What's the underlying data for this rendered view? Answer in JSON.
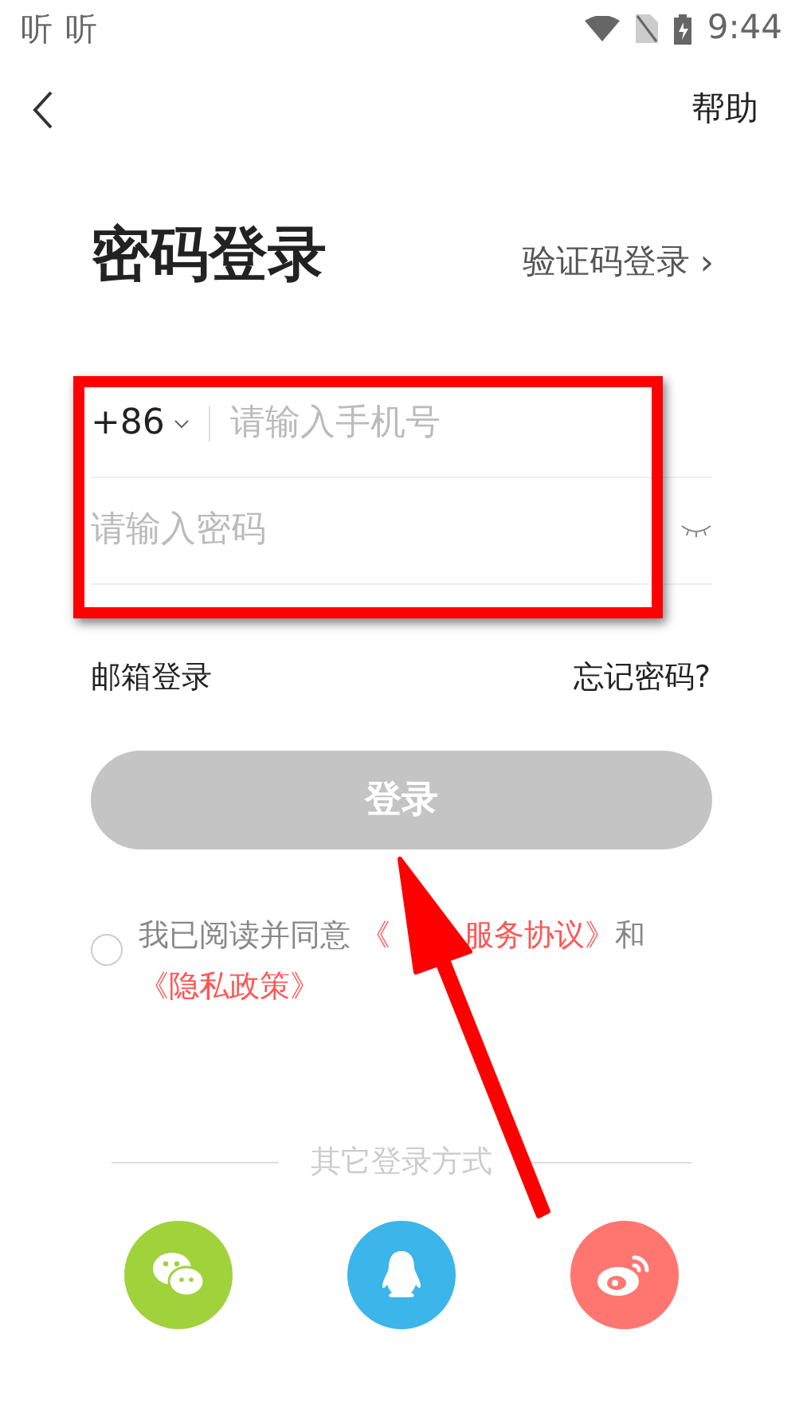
{
  "status_bar": {
    "app_name": "听",
    "app_name_2": "听",
    "time": "9:44"
  },
  "header": {
    "help": "帮助"
  },
  "title": "密码登录",
  "switch_link": "验证码登录",
  "switch_arrow": "›",
  "phone": {
    "country_code": "+86",
    "placeholder": "请输入手机号"
  },
  "password": {
    "placeholder": "请输入密码"
  },
  "email_login": "邮箱登录",
  "forgot": "忘记密码?",
  "login_button": {
    "label": "登录",
    "disabled": true
  },
  "agreement": {
    "checked": false,
    "prefix": "我已阅读并同意",
    "terms_start": "《",
    "terms": "服务协议》",
    "and": "和",
    "privacy": "《隐私政策》"
  },
  "other_login": {
    "label": "其它登录方式"
  },
  "social": [
    {
      "kind": "wechat",
      "color": "#a0d23b"
    },
    {
      "kind": "qq",
      "color": "#3bb5ea"
    },
    {
      "kind": "weibo",
      "color": "#ff7670"
    }
  ]
}
